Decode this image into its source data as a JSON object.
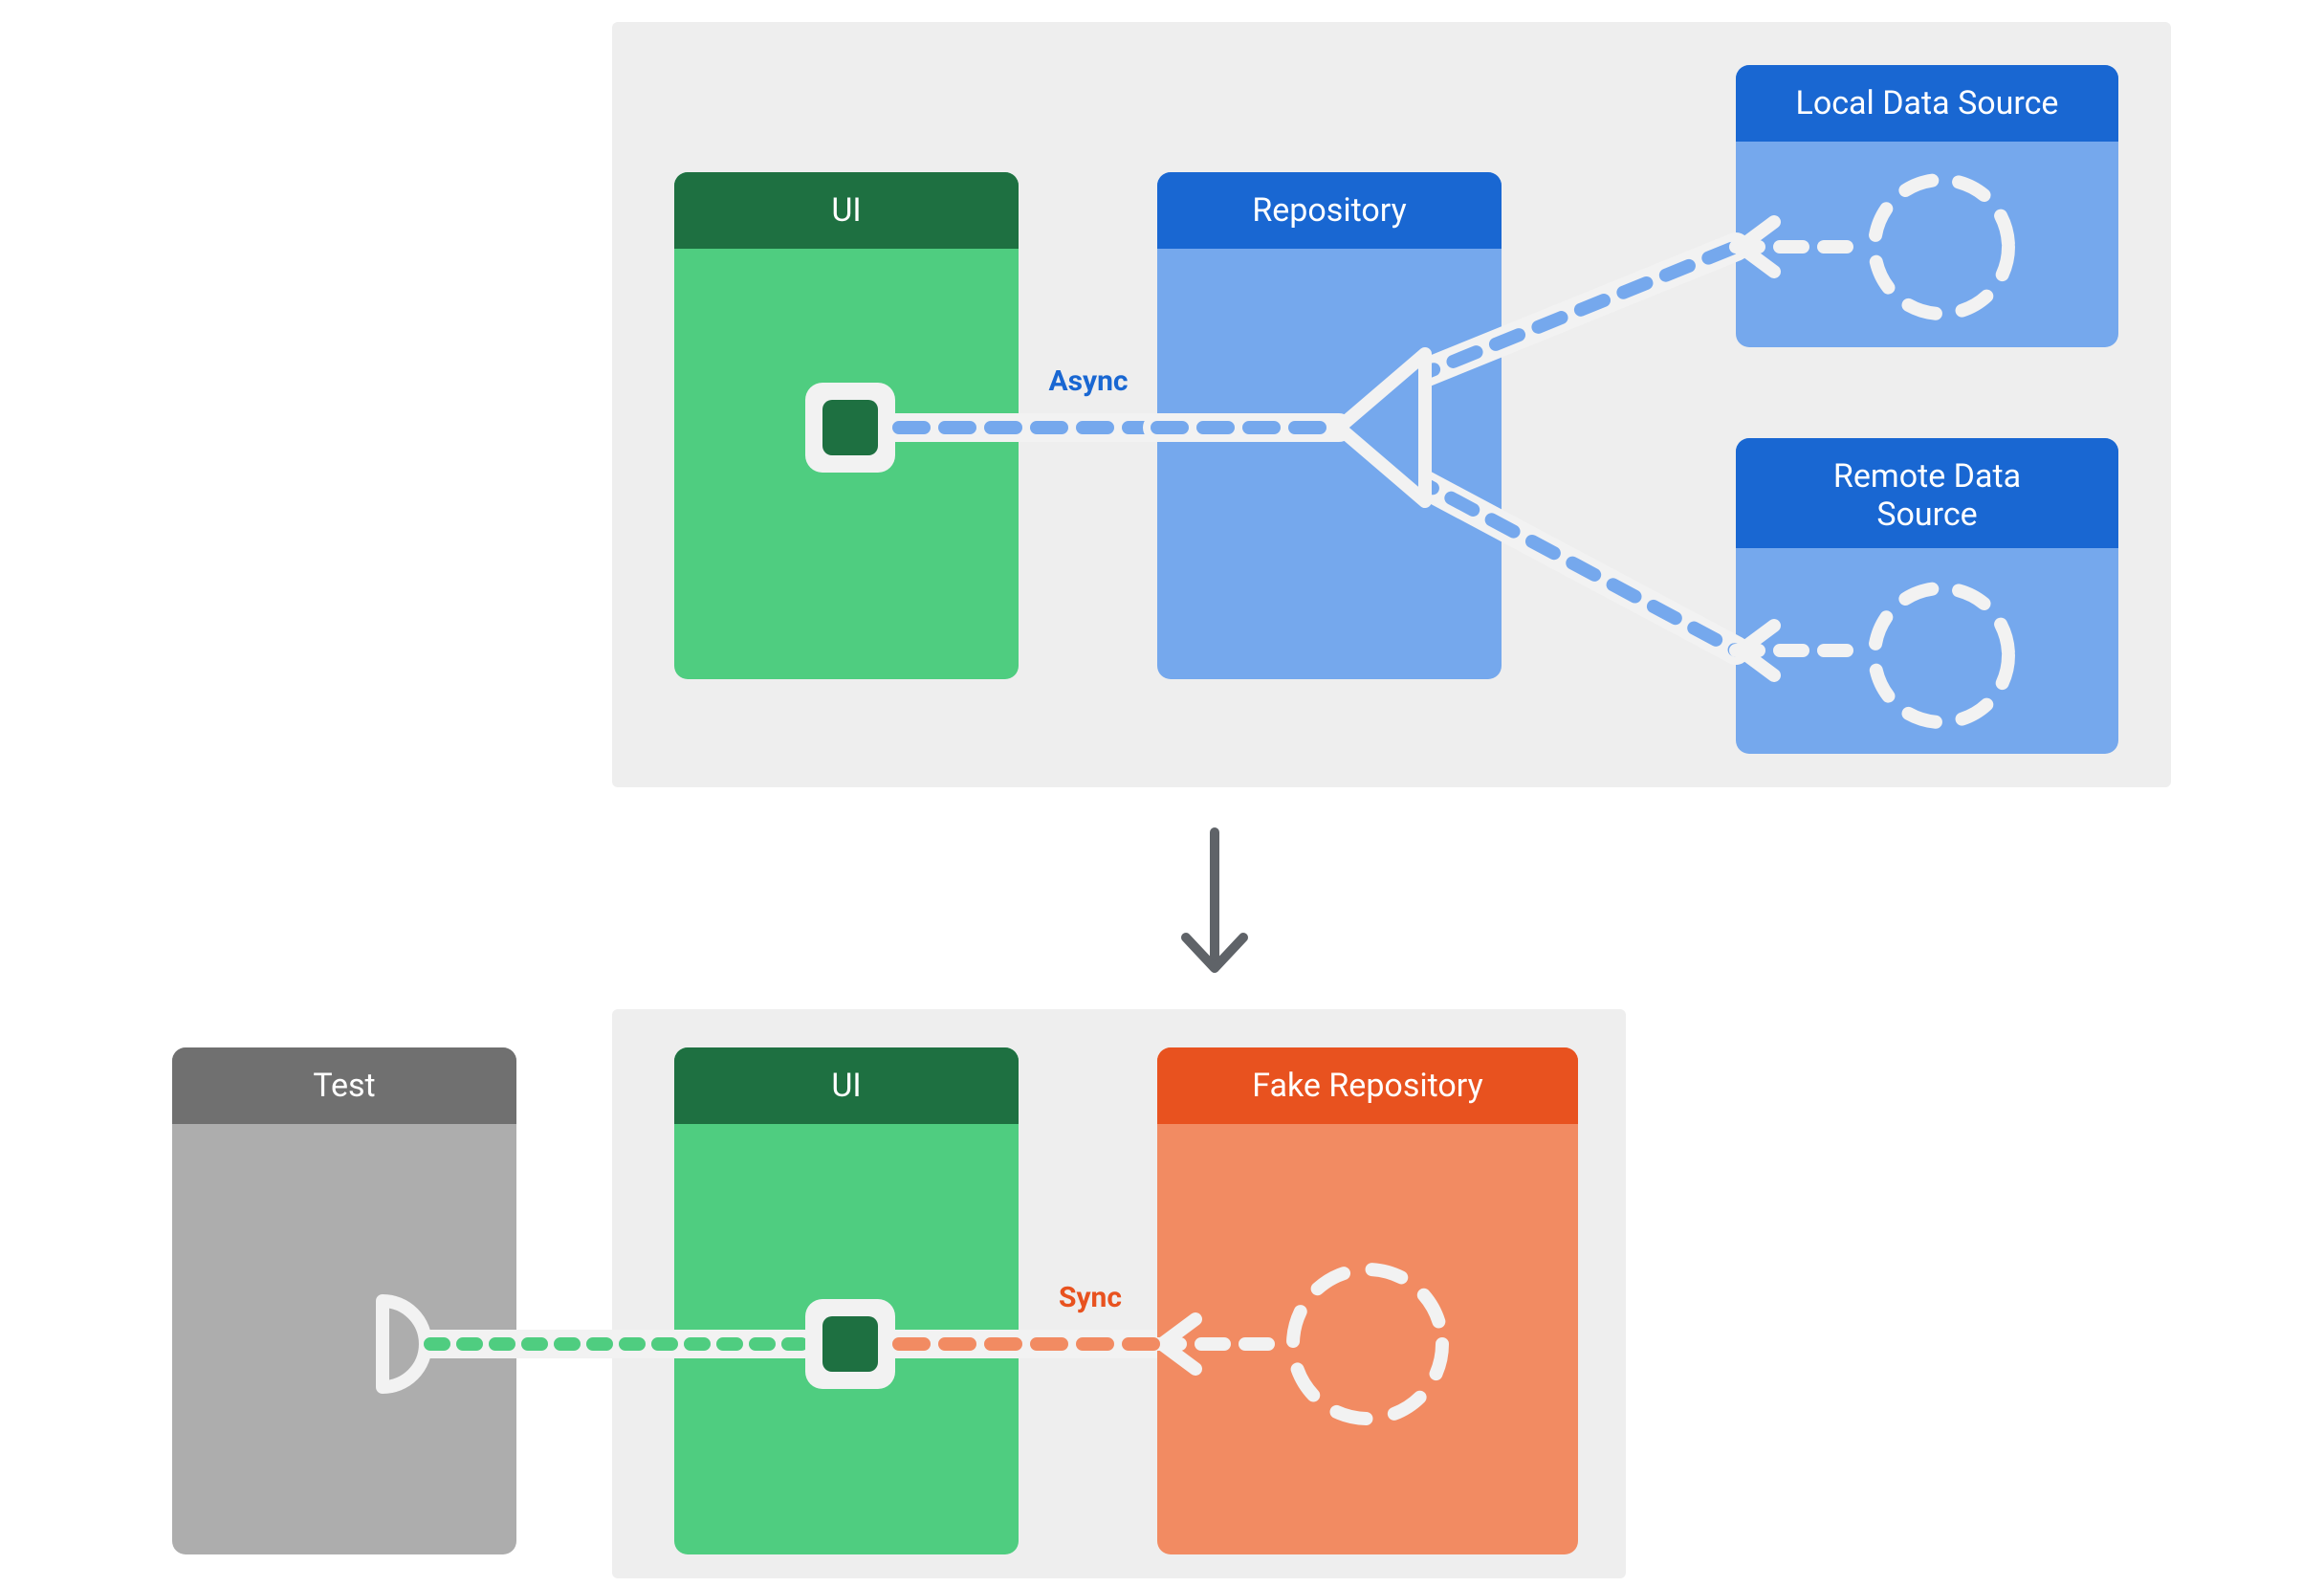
{
  "diagram": {
    "top": {
      "ui_label": "UI",
      "repo_label": "Repository",
      "local_ds_label": "Local Data Source",
      "remote_ds_label_line1": "Remote Data",
      "remote_ds_label_line2": "Source",
      "async_label": "Async"
    },
    "bottom": {
      "test_label": "Test",
      "ui_label": "UI",
      "fake_repo_label": "Fake Repository",
      "sync_label": "Sync"
    },
    "colors": {
      "panel_bg": "#EEEEEE",
      "green_header": "#1E7041",
      "green_body": "#4FCD80",
      "blue_header": "#1967D2",
      "blue_body": "#75A8ED",
      "orange_header": "#E8521F",
      "orange_body": "#F28B62",
      "test_header": "#707070",
      "test_body": "#ADADAD",
      "white": "#F2F2F2",
      "arrow_gray": "#5F6368",
      "async_text": "#1967D2",
      "sync_text": "#E8521F"
    }
  }
}
